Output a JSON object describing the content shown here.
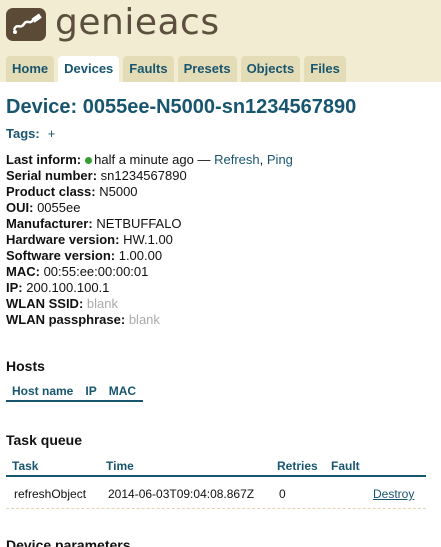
{
  "app": {
    "brand": "genieacs"
  },
  "nav": {
    "tabs": [
      {
        "label": "Home"
      },
      {
        "label": "Devices"
      },
      {
        "label": "Faults"
      },
      {
        "label": "Presets"
      },
      {
        "label": "Objects"
      },
      {
        "label": "Files"
      }
    ],
    "active_tab": "Devices"
  },
  "device": {
    "title": "Device: 0055ee-N5000-sn1234567890",
    "tags_label": "Tags:",
    "tags_add": "+",
    "last_inform": {
      "label": "Last inform:",
      "value": "half a minute ago",
      "separator": "—",
      "refresh": "Refresh",
      "comma": ",",
      "ping": "Ping",
      "status_color": "#30a030"
    },
    "fields": [
      {
        "label": "Serial number:",
        "value": "sn1234567890"
      },
      {
        "label": "Product class:",
        "value": "N5000"
      },
      {
        "label": "OUI:",
        "value": "0055ee"
      },
      {
        "label": "Manufacturer:",
        "value": "NETBUFFALO"
      },
      {
        "label": "Hardware version:",
        "value": "HW.1.00"
      },
      {
        "label": "Software version:",
        "value": "1.00.00"
      },
      {
        "label": "MAC:",
        "value": "00:55:ee:00:00:01"
      },
      {
        "label": "IP:",
        "value": "200.100.100.1"
      },
      {
        "label": "WLAN SSID:",
        "value": "blank"
      },
      {
        "label": "WLAN passphrase:",
        "value": "blank"
      }
    ]
  },
  "hosts": {
    "title": "Hosts",
    "columns": [
      "Host name",
      "IP",
      "MAC"
    ]
  },
  "task_queue": {
    "title": "Task queue",
    "columns": [
      "Task",
      "Time",
      "Retries",
      "Fault"
    ],
    "rows": [
      {
        "task": "refreshObject",
        "time": "2014-06-03T09:04:08.867Z",
        "retries": "0",
        "action": "Destroy"
      }
    ]
  },
  "device_parameters": {
    "title": "Device parameters"
  },
  "colors": {
    "accent": "#18566f",
    "header_bg": "#f2ecd3",
    "tab_bg": "#e4dcb6"
  }
}
